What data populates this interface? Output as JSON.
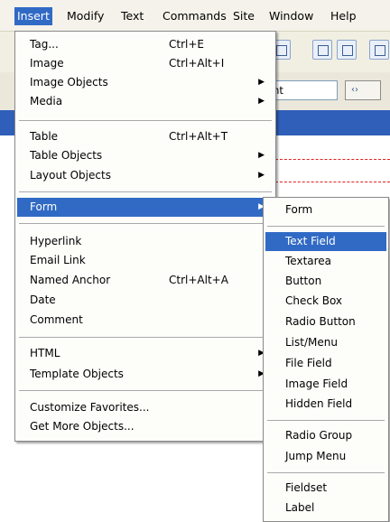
{
  "menubar": {
    "items": [
      "Insert",
      "Modify",
      "Text",
      "Commands",
      "Site",
      "Window",
      "Help"
    ]
  },
  "background": {
    "field_text": "ent",
    "button_glyph": "‹›"
  },
  "insert_menu": {
    "items": [
      {
        "label": "Tag...",
        "shortcut": "Ctrl+E"
      },
      {
        "label": "Image",
        "shortcut": "Ctrl+Alt+I"
      },
      {
        "label": "Image Objects",
        "submenu": true
      },
      {
        "label": "Media",
        "submenu": true
      },
      {
        "label": "Table",
        "shortcut": "Ctrl+Alt+T"
      },
      {
        "label": "Table Objects",
        "submenu": true
      },
      {
        "label": "Layout Objects",
        "submenu": true
      },
      {
        "label": "Form",
        "submenu": true,
        "highlighted": true
      },
      {
        "label": "Hyperlink"
      },
      {
        "label": "Email Link"
      },
      {
        "label": "Named Anchor",
        "shortcut": "Ctrl+Alt+A"
      },
      {
        "label": "Date"
      },
      {
        "label": "Comment"
      },
      {
        "label": "HTML",
        "submenu": true
      },
      {
        "label": "Template Objects",
        "submenu": true
      },
      {
        "label": "Customize Favorites..."
      },
      {
        "label": "Get More Objects..."
      }
    ]
  },
  "form_submenu": {
    "items": [
      {
        "label": "Form"
      },
      {
        "label": "Text Field",
        "highlighted": true
      },
      {
        "label": "Textarea"
      },
      {
        "label": "Button"
      },
      {
        "label": "Check Box"
      },
      {
        "label": "Radio Button"
      },
      {
        "label": "List/Menu"
      },
      {
        "label": "File Field"
      },
      {
        "label": "Image Field"
      },
      {
        "label": "Hidden Field"
      },
      {
        "label": "Radio Group"
      },
      {
        "label": "Jump Menu"
      },
      {
        "label": "Fieldset"
      },
      {
        "label": "Label"
      }
    ]
  },
  "colors": {
    "highlight": "#316ac5",
    "menubar_bg": "#f4f2ea",
    "menu_bg": "#fdfdfa",
    "blue_band": "#2f5fb8",
    "dashed_line": "#e02020"
  }
}
